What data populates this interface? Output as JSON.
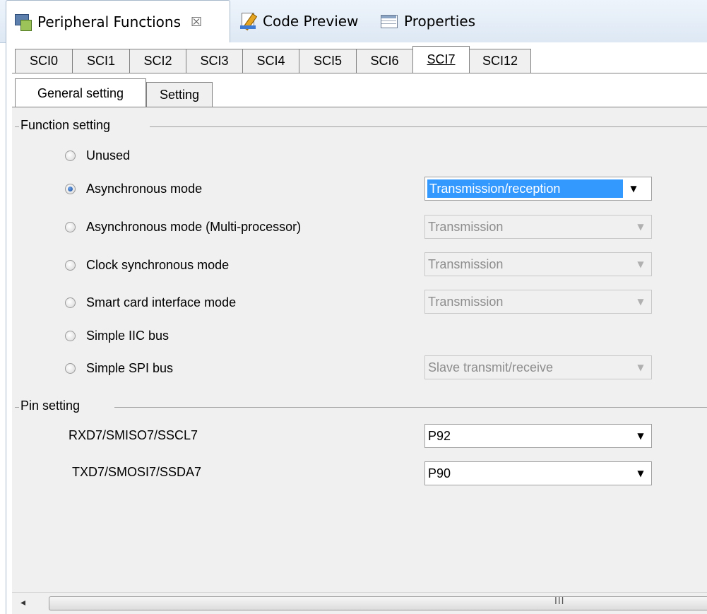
{
  "view_tabs": [
    {
      "label": "Peripheral Functions",
      "icon": "peripheral-functions-icon",
      "active": true,
      "close": "☒"
    },
    {
      "label": "Code Preview",
      "icon": "code-preview-icon",
      "active": false
    },
    {
      "label": "Properties",
      "icon": "properties-icon",
      "active": false
    }
  ],
  "sci_tabs": [
    "SCI0",
    "SCI1",
    "SCI2",
    "SCI3",
    "SCI4",
    "SCI5",
    "SCI6",
    "SCI7",
    "SCI12"
  ],
  "sci_active": "SCI7",
  "sub_tabs": [
    "General setting",
    "Setting"
  ],
  "sub_active": "General setting",
  "function_setting": {
    "title": "Function setting",
    "options": [
      {
        "label": "Unused",
        "selected": false
      },
      {
        "label": "Asynchronous mode",
        "selected": true,
        "combo": "Transmission/reception",
        "combo_enabled": true
      },
      {
        "label": "Asynchronous  mode  (Multi-processor)",
        "selected": false,
        "combo": "Transmission",
        "combo_enabled": false
      },
      {
        "label": "Clock synchronous mode",
        "selected": false,
        "combo": "Transmission",
        "combo_enabled": false
      },
      {
        "label": "Smart card interface mode",
        "selected": false,
        "combo": "Transmission",
        "combo_enabled": false
      },
      {
        "label": "Simple IIC bus",
        "selected": false
      },
      {
        "label": "Simple SPI bus",
        "selected": false,
        "combo": "Slave transmit/receive",
        "combo_enabled": false
      }
    ]
  },
  "pin_setting": {
    "title": "Pin setting",
    "pins": [
      {
        "label": "RXD7/SMISO7/SSCL7",
        "value": "P92"
      },
      {
        "label": "TXD7/SMOSI7/SSDA7",
        "value": "P90"
      }
    ]
  },
  "scrollbar": {
    "left_arrow": "◂",
    "grip": "III"
  },
  "colors": {
    "selection": "#3399ff",
    "panel_bg": "#f0f0f0",
    "disabled_text": "#8d8d8d"
  }
}
